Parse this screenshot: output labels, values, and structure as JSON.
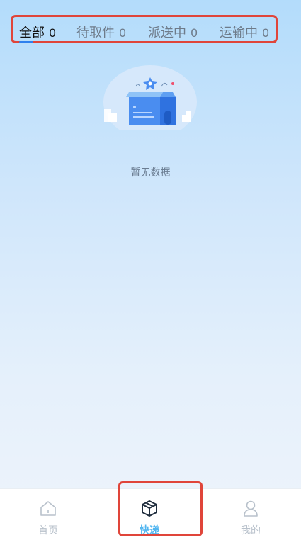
{
  "tabs": [
    {
      "label": "全部",
      "count": "0",
      "active": true
    },
    {
      "label": "待取件",
      "count": "0",
      "active": false
    },
    {
      "label": "派送中",
      "count": "0",
      "active": false
    },
    {
      "label": "运输中",
      "count": "0",
      "active": false
    }
  ],
  "empty": {
    "text": "暂无数据",
    "icon": "empty-box-illustration"
  },
  "tabbar": [
    {
      "label": "首页",
      "icon": "home-icon",
      "active": false
    },
    {
      "label": "快递",
      "icon": "package-box-icon",
      "active": true
    },
    {
      "label": "我的",
      "icon": "person-icon",
      "active": false
    }
  ],
  "colors": {
    "accent": "#52b6f0",
    "highlight_border": "#e0453a",
    "tab_underline": "#2f80ed"
  }
}
